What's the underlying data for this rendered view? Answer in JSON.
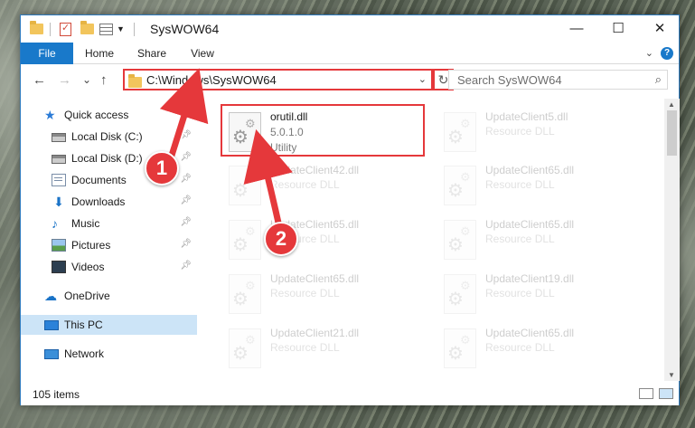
{
  "window": {
    "title": "SysWOW64",
    "minimize": "—",
    "maximize": "☐",
    "close": "✕"
  },
  "ribbon": {
    "tabs": [
      "File",
      "Home",
      "Share",
      "View"
    ],
    "help": "?"
  },
  "nav": {
    "back": "←",
    "forward": "→",
    "recent": "⌄",
    "up": "↑",
    "address": "C:\\Windows\\SysWOW64",
    "refresh": "↻",
    "search_placeholder": "Search SysWOW64"
  },
  "sidebar": {
    "items": [
      {
        "label": "Quick access",
        "icon": "star-icon"
      },
      {
        "label": "Local Disk (C:)",
        "icon": "drive-icon",
        "pinned": true
      },
      {
        "label": "Local Disk (D:)",
        "icon": "drive-icon",
        "pinned": true
      },
      {
        "label": "Documents",
        "icon": "documents-icon",
        "pinned": true
      },
      {
        "label": "Downloads",
        "icon": "downloads-icon",
        "pinned": true
      },
      {
        "label": "Music",
        "icon": "music-icon",
        "pinned": true
      },
      {
        "label": "Pictures",
        "icon": "pictures-icon",
        "pinned": true
      },
      {
        "label": "Videos",
        "icon": "videos-icon",
        "pinned": true
      },
      {
        "label": "OneDrive",
        "icon": "onedrive-icon"
      },
      {
        "label": "This PC",
        "icon": "this-pc-icon",
        "selected": true
      },
      {
        "label": "Network",
        "icon": "network-icon"
      }
    ]
  },
  "files": {
    "highlighted": {
      "name": "orutil.dll",
      "version": "5.0.1.0",
      "type": "Utility"
    },
    "left_column": [
      {
        "name": "UpdateClient42.dll",
        "type": "Resource DLL"
      },
      {
        "name": "UpdateClient65.dll",
        "type": "Resource DLL"
      },
      {
        "name": "UpdateClient65.dll",
        "type": "Resource DLL"
      },
      {
        "name": "UpdateClient21.dll",
        "type": "Resource DLL"
      }
    ],
    "right_column": [
      {
        "name": "UpdateClient5.dll",
        "type": "Resource DLL"
      },
      {
        "name": "UpdateClient65.dll",
        "type": "Resource DLL"
      },
      {
        "name": "UpdateClient65.dll",
        "type": "Resource DLL"
      },
      {
        "name": "UpdateClient19.dll",
        "type": "Resource DLL"
      },
      {
        "name": "UpdateClient65.dll",
        "type": "Resource DLL"
      }
    ]
  },
  "status": {
    "item_count": "105 items"
  },
  "callouts": [
    "1",
    "2"
  ],
  "colors": {
    "accent": "#1979ca",
    "highlight": "#e5383b",
    "selection": "#cce4f7"
  }
}
